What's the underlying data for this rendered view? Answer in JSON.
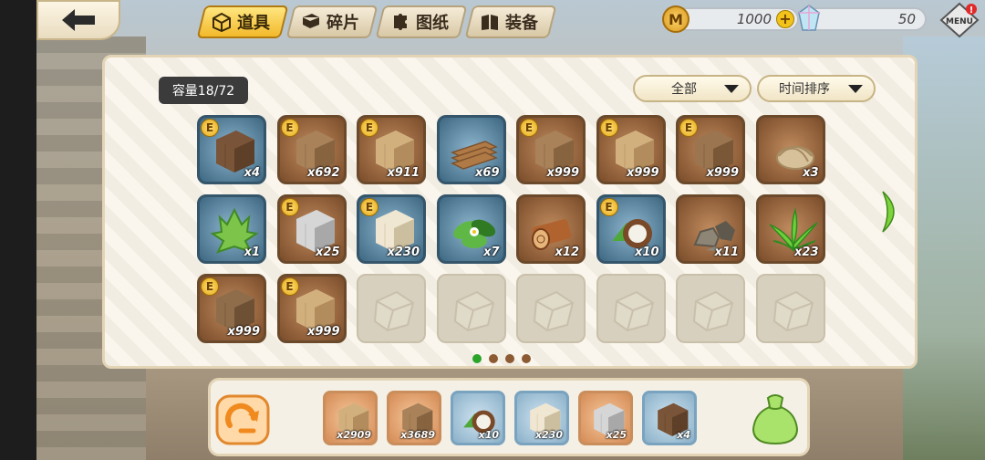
{
  "header": {
    "tabs": [
      {
        "label": "道具",
        "icon": "box-icon",
        "active": true
      },
      {
        "label": "碎片",
        "icon": "book-icon",
        "active": false
      },
      {
        "label": "图纸",
        "icon": "puzzle-icon",
        "active": false
      },
      {
        "label": "装备",
        "icon": "book-open-icon",
        "active": false
      }
    ],
    "coins": "1000",
    "gems": "50",
    "coin_symbol": "M",
    "menu_label": "MENU",
    "menu_alert": "!"
  },
  "inventory": {
    "capacity": "容量18/72",
    "filter": "全部",
    "sort": "时间排序",
    "badge_letter": "E",
    "items": [
      {
        "name": "wood-block-dark",
        "qty": "x4",
        "style": "blue",
        "badge": true,
        "kind": "cube",
        "c1": "#7a5538",
        "c2": "#5e3f28"
      },
      {
        "name": "wood-block",
        "qty": "x692",
        "style": "brown",
        "badge": true,
        "kind": "cube",
        "c1": "#a9825a",
        "c2": "#876340"
      },
      {
        "name": "light-wood-block",
        "qty": "x911",
        "style": "brown",
        "badge": true,
        "kind": "cube",
        "c1": "#d2b07e",
        "c2": "#b28c5c"
      },
      {
        "name": "planks",
        "qty": "x69",
        "style": "blue",
        "badge": false,
        "kind": "planks",
        "c1": "#b07a46",
        "c2": "#7c512c"
      },
      {
        "name": "wood-block",
        "qty": "x999",
        "style": "brown",
        "badge": true,
        "kind": "cube",
        "c1": "#a9825a",
        "c2": "#876340"
      },
      {
        "name": "light-wood-block",
        "qty": "x999",
        "style": "brown",
        "badge": true,
        "kind": "cube",
        "c1": "#d2b07e",
        "c2": "#b28c5c"
      },
      {
        "name": "wood-block",
        "qty": "x999",
        "style": "brown",
        "badge": true,
        "kind": "cube",
        "c1": "#9a7550",
        "c2": "#7a5737"
      },
      {
        "name": "fiber",
        "qty": "x3",
        "style": "brown",
        "badge": false,
        "kind": "fiber",
        "c1": "#d7c19a",
        "c2": "#a68b62"
      },
      {
        "name": "bush",
        "qty": "x1",
        "style": "blue",
        "badge": false,
        "kind": "bush",
        "c1": "#7cc44a",
        "c2": "#3f8a25"
      },
      {
        "name": "stone-block",
        "qty": "x25",
        "style": "brown",
        "badge": true,
        "kind": "cube",
        "c1": "#d6d6d6",
        "c2": "#a8a8a8"
      },
      {
        "name": "stone-brick",
        "qty": "x230",
        "style": "blue",
        "badge": true,
        "kind": "cube",
        "c1": "#efe6d2",
        "c2": "#cbbf9f"
      },
      {
        "name": "leaves-flower",
        "qty": "x7",
        "style": "blue",
        "badge": false,
        "kind": "leaf",
        "c1": "#5fb845",
        "c2": "#2f7a22"
      },
      {
        "name": "log",
        "qty": "x12",
        "style": "brown",
        "badge": false,
        "kind": "log",
        "c1": "#b0632e",
        "c2": "#7a3d19"
      },
      {
        "name": "coconut",
        "qty": "x10",
        "style": "blue",
        "badge": true,
        "kind": "coconut",
        "c1": "#7a4a28",
        "c2": "#f4f1e8"
      },
      {
        "name": "rocks",
        "qty": "x11",
        "style": "brown",
        "badge": false,
        "kind": "rocks",
        "c1": "#8d8677",
        "c2": "#5e584d"
      },
      {
        "name": "grass",
        "qty": "x23",
        "style": "brown",
        "badge": false,
        "kind": "grass",
        "c1": "#6fcf3a",
        "c2": "#2f8b1e"
      },
      {
        "name": "wood-block",
        "qty": "x999",
        "style": "brown",
        "badge": true,
        "kind": "cube",
        "c1": "#8f6d4b",
        "c2": "#6e5035"
      },
      {
        "name": "light-wood-block",
        "qty": "x999",
        "style": "brown",
        "badge": true,
        "kind": "cube",
        "c1": "#d2b07e",
        "c2": "#b28c5c"
      },
      {
        "name": "empty",
        "qty": "",
        "style": "empty",
        "badge": false,
        "kind": "empty"
      },
      {
        "name": "empty",
        "qty": "",
        "style": "empty",
        "badge": false,
        "kind": "empty"
      },
      {
        "name": "empty",
        "qty": "",
        "style": "empty",
        "badge": false,
        "kind": "empty"
      },
      {
        "name": "empty",
        "qty": "",
        "style": "empty",
        "badge": false,
        "kind": "empty"
      },
      {
        "name": "empty",
        "qty": "",
        "style": "empty",
        "badge": false,
        "kind": "empty"
      },
      {
        "name": "empty",
        "qty": "",
        "style": "empty",
        "badge": false,
        "kind": "empty"
      }
    ],
    "pages": 4,
    "current_page": 1
  },
  "quickbar": {
    "items": [
      {
        "name": "light-wood-block",
        "qty": "x2909",
        "style": "orange",
        "kind": "cube",
        "c1": "#d2b07e",
        "c2": "#b28c5c"
      },
      {
        "name": "wood-block",
        "qty": "x3689",
        "style": "orange",
        "kind": "cube",
        "c1": "#a9825a",
        "c2": "#876340"
      },
      {
        "name": "coconut",
        "qty": "x10",
        "style": "blue",
        "kind": "coconut",
        "c1": "#7a4a28",
        "c2": "#f4f1e8"
      },
      {
        "name": "stone-brick",
        "qty": "x230",
        "style": "blue",
        "kind": "cube",
        "c1": "#efe6d2",
        "c2": "#cbbf9f"
      },
      {
        "name": "stone-block",
        "qty": "x25",
        "style": "orange",
        "kind": "cube",
        "c1": "#d6d6d6",
        "c2": "#a8a8a8"
      },
      {
        "name": "wood-block-dark",
        "qty": "x4",
        "style": "blue",
        "kind": "cube",
        "c1": "#7a5538",
        "c2": "#5e3f28"
      }
    ]
  }
}
